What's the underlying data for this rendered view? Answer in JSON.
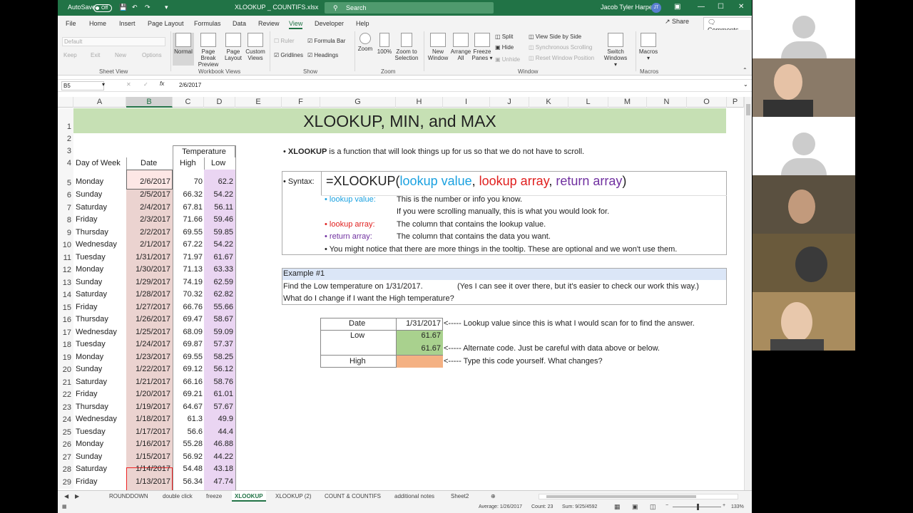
{
  "titlebar": {
    "autosave": "AutoSave",
    "autosave_state": "Off",
    "filename": "XLOOKUP _ COUNTIFS.xlsx",
    "search": "Search",
    "user": "Jacob Tyler Harper",
    "initials": "JT"
  },
  "menu": {
    "items": [
      "File",
      "Home",
      "Insert",
      "Page Layout",
      "Formulas",
      "Data",
      "Review",
      "View",
      "Developer",
      "Help"
    ],
    "share": "Share",
    "comments": "Comments"
  },
  "ribbon": {
    "sheet_view": {
      "default": "Default",
      "keep": "Keep",
      "exit": "Exit",
      "new": "New",
      "options": "Options",
      "group": "Sheet View"
    },
    "workbook_views": {
      "normal": "Normal",
      "page_break": "Page Break",
      "page_break2": "Preview",
      "page_layout": "Page",
      "page_layout2": "Layout",
      "custom": "Custom",
      "custom2": "Views",
      "group": "Workbook Views"
    },
    "show": {
      "ruler": "Ruler",
      "formula_bar": "Formula Bar",
      "gridlines": "Gridlines",
      "headings": "Headings",
      "group": "Show"
    },
    "zoom": {
      "zoom": "Zoom",
      "100": "100%",
      "zoom_sel": "Zoom to",
      "zoom_sel2": "Selection",
      "group": "Zoom"
    },
    "window": {
      "new_window": "New",
      "new_window2": "Window",
      "arrange": "Arrange",
      "arrange2": "All",
      "freeze": "Freeze",
      "freeze2": "Panes",
      "split": "Split",
      "hide": "Hide",
      "unhide": "Unhide",
      "side": "View Side by Side",
      "sync": "Synchronous Scrolling",
      "reset": "Reset Window Position",
      "switch": "Switch",
      "switch2": "Windows",
      "group": "Window"
    },
    "macros": {
      "label": "Macros",
      "group": "Macros"
    }
  },
  "formula_bar": {
    "name_box": "B5",
    "value": "2/6/2017"
  },
  "columns": [
    "A",
    "B",
    "C",
    "D",
    "E",
    "F",
    "G",
    "H",
    "I",
    "J",
    "K",
    "L",
    "M",
    "N",
    "O",
    "P"
  ],
  "sheet": {
    "title": "XLOOKUP, MIN, and MAX",
    "temperature": "Temperature",
    "hdr_day": "Day of Week",
    "hdr_date": "Date",
    "hdr_high": "High",
    "hdr_low": "Low",
    "rows": [
      [
        "5",
        "Monday",
        "2/6/2017",
        "70",
        "62.2"
      ],
      [
        "6",
        "Sunday",
        "2/5/2017",
        "66.32",
        "54.22"
      ],
      [
        "7",
        "Saturday",
        "2/4/2017",
        "67.81",
        "56.11"
      ],
      [
        "8",
        "Friday",
        "2/3/2017",
        "71.66",
        "59.46"
      ],
      [
        "9",
        "Thursday",
        "2/2/2017",
        "69.55",
        "59.85"
      ],
      [
        "10",
        "Wednesday",
        "2/1/2017",
        "67.22",
        "54.22"
      ],
      [
        "11",
        "Tuesday",
        "1/31/2017",
        "71.97",
        "61.67"
      ],
      [
        "12",
        "Monday",
        "1/30/2017",
        "71.13",
        "63.33"
      ],
      [
        "13",
        "Sunday",
        "1/29/2017",
        "74.19",
        "62.59"
      ],
      [
        "14",
        "Saturday",
        "1/28/2017",
        "70.32",
        "62.82"
      ],
      [
        "15",
        "Friday",
        "1/27/2017",
        "66.76",
        "55.66"
      ],
      [
        "16",
        "Thursday",
        "1/26/2017",
        "69.47",
        "58.67"
      ],
      [
        "17",
        "Wednesday",
        "1/25/2017",
        "68.09",
        "59.09"
      ],
      [
        "18",
        "Tuesday",
        "1/24/2017",
        "69.87",
        "57.37"
      ],
      [
        "19",
        "Monday",
        "1/23/2017",
        "69.55",
        "58.25"
      ],
      [
        "20",
        "Sunday",
        "1/22/2017",
        "69.12",
        "56.12"
      ],
      [
        "21",
        "Saturday",
        "1/21/2017",
        "66.16",
        "58.76"
      ],
      [
        "22",
        "Friday",
        "1/20/2017",
        "69.21",
        "61.01"
      ],
      [
        "23",
        "Thursday",
        "1/19/2017",
        "64.67",
        "57.67"
      ],
      [
        "24",
        "Wednesday",
        "1/18/2017",
        "61.3",
        "49.9"
      ],
      [
        "25",
        "Tuesday",
        "1/17/2017",
        "56.6",
        "44.4"
      ],
      [
        "26",
        "Monday",
        "1/16/2017",
        "55.28",
        "46.88"
      ],
      [
        "27",
        "Sunday",
        "1/15/2017",
        "56.92",
        "44.22"
      ],
      [
        "28",
        "Saturday",
        "1/14/2017",
        "54.48",
        "43.18"
      ],
      [
        "29",
        "Friday",
        "1/13/2017",
        "56.34",
        "47.74"
      ]
    ],
    "intro_bold": "XLOOKUP",
    "intro_rest": " is a function that will look things up for us so that we do not have to scroll.",
    "syntax_label": "Syntax:",
    "syntax_pre": "=XLOOKUP(",
    "syntax_a": "lookup value",
    "syntax_comma1": ", ",
    "syntax_b": "lookup array",
    "syntax_comma2": ", ",
    "syntax_c": "return array",
    "syntax_post": ")",
    "lv_label": "lookup value:",
    "lv_desc1": "This is the number or info you know.",
    "lv_desc2": "If you were scrolling manually, this is what you would look for.",
    "la_label": "lookup array:",
    "la_desc": "The column that contains the lookup value.",
    "ra_label": "return array:",
    "ra_desc": "The column that contains the data you want.",
    "tooltip_note": "You might notice that there are more things in the tooltip. These are optional and we won't use them.",
    "example_title": "Example #1",
    "ex_line1": "Find the Low temperature on 1/31/2017.",
    "ex_line1b": "(Yes I can see it over there, but it's easier to check our work this way.)",
    "ex_line2": "What do I change if I want the High temperature?",
    "t_date": "Date",
    "t_date_val": "1/31/2017",
    "t_low": "Low",
    "t_low_val": "61.67",
    "t_low_val2": "61.67",
    "t_high": "High",
    "note1": "<----- Lookup value since this is what I would scan for to find the answer.",
    "note2": "<----- Alternate code. Just be careful with data above or below.",
    "note3": "<----- Type this code yourself. What changes?"
  },
  "tabs": [
    "ROUNDDOWN",
    "double click",
    "freeze",
    "XLOOKUP",
    "XLOOKUP (2)",
    "COUNT & COUNTIFS",
    "additional notes",
    "Sheet2"
  ],
  "status": {
    "average": "Average: 1/26/2017",
    "count": "Count: 23",
    "sum": "Sum: 9/25/4592",
    "zoom": "133%"
  },
  "colors": {
    "excel_green": "#217346",
    "banner": "#c6e0b4",
    "lookup_value": "#1aa1e0",
    "lookup_array": "#e0201f",
    "return_array": "#7030a0",
    "low_cell": "#a9d18e",
    "high_cell": "#f4b183"
  }
}
